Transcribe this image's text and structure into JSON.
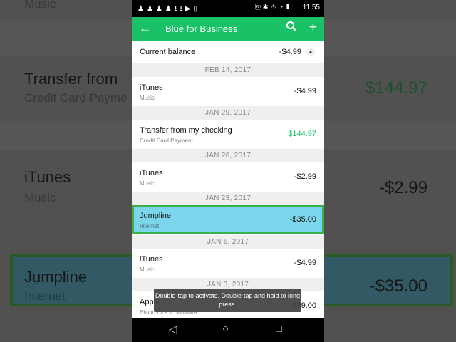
{
  "status": {
    "left_icons": "♟♟♟♟⭳⭳▶▯",
    "right_icons": "⎘✱⚠◔▮",
    "time": "11:55"
  },
  "appbar": {
    "title": "Blue for Business",
    "back_icon": "arrow-left-icon",
    "search_icon": "search-icon",
    "add_icon": "plus-icon"
  },
  "balance": {
    "label": "Current balance",
    "amount": "-$4.99"
  },
  "entries": [
    {
      "date": "FEB 14, 2017",
      "title": "iTunes",
      "subtitle": "Music",
      "amount": "-$4.99"
    },
    {
      "date": "JAN 29, 2017",
      "title": "Transfer from my checking",
      "subtitle": "Credit Card Payment",
      "amount": "$144.97"
    },
    {
      "date": "JAN 26, 2017",
      "title": "iTunes",
      "subtitle": "Music",
      "amount": "-$2.99"
    },
    {
      "date": "JAN 23, 2017",
      "title": "Jumpline",
      "subtitle": "Internet",
      "amount": "-$35.00"
    },
    {
      "date": "JAN 6, 2017",
      "title": "iTunes",
      "subtitle": "Music",
      "amount": "-$4.99"
    },
    {
      "date": "JAN 3, 2017",
      "title": "Apple",
      "subtitle": "Electronics & Software",
      "amount": "-$99.00"
    }
  ],
  "toast": "Double-tap to activate. Double-tap and hold to long press.",
  "colors": {
    "accent": "#1bc167",
    "highlight": "#7bd6ec",
    "focus_border": "#3cb04a"
  },
  "background": {
    "top_text": "Music",
    "transfer_title": "Transfer from",
    "transfer_sub": "Credit Card Payme",
    "transfer_amount": "$144.97",
    "itunes_title": "iTunes",
    "itunes_sub": "Music",
    "itunes_amount": "-$2.99",
    "jump_title": "Jumpline",
    "jump_sub": "Internet",
    "jump_amount": "-$35.00"
  }
}
